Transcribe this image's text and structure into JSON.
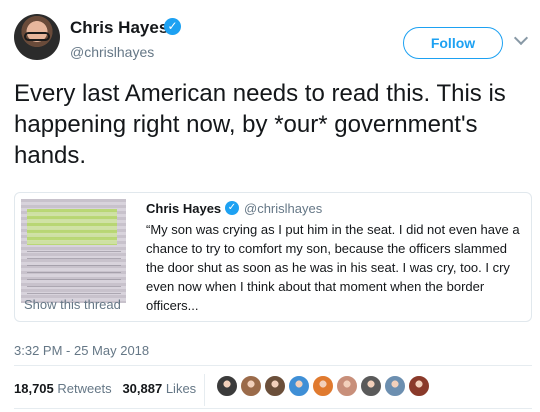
{
  "author": {
    "name": "Chris Hayes",
    "handle": "@chrislhayes",
    "verified_icon": "✓"
  },
  "follow_label": "Follow",
  "tweet_text": "Every last American needs to read this. This is happening right now, by *our* government's hands.",
  "quoted_tweet": {
    "name": "Chris Hayes",
    "handle": "@chrislhayes",
    "text": "“My son was crying as I put him in the seat. I did not even have a chance to try to comfort my son, because the officers slammed the door shut as soon as he was in his seat. I was cry, too. I cry even now when I think about that moment when the border officers..."
  },
  "show_thread": "Show this thread",
  "timestamp": "3:32 PM - 25 May 2018",
  "stats": {
    "retweets_count": "18,705",
    "retweets_label": "Retweets",
    "likes_count": "30,887",
    "likes_label": "Likes"
  },
  "colors": {
    "accent": "#1da1f2",
    "muted": "#657786",
    "text": "#14171a"
  },
  "likers": [
    {
      "color": "#3b3b3b"
    },
    {
      "color": "#9b6b4a"
    },
    {
      "color": "#6b4f3a"
    },
    {
      "color": "#3f8fd6"
    },
    {
      "color": "#e07a2f"
    },
    {
      "color": "#c88f7a"
    },
    {
      "color": "#5a5a5a"
    },
    {
      "color": "#6c8fb0"
    },
    {
      "color": "#8a3a2a"
    }
  ]
}
